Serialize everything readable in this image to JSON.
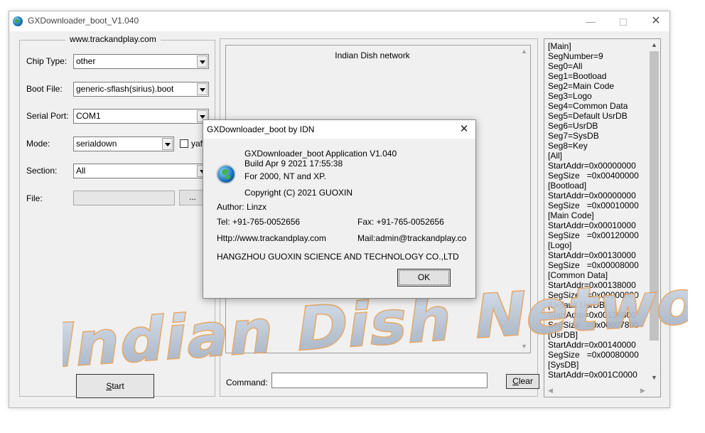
{
  "window": {
    "title": "GXDownloader_boot_V1.040",
    "min_glyph": "—",
    "close_glyph": "✕"
  },
  "left_panel": {
    "group_title": "www.trackandplay.com",
    "chip_type_label": "Chip Type:",
    "chip_type_value": "other",
    "boot_file_label": "Boot File:",
    "boot_file_value": "generic-sflash(sirius).boot",
    "serial_port_label": "Serial Port:",
    "serial_port_value": "COM1",
    "mode_label": "Mode:",
    "mode_value": "serialdown",
    "mode_checkbox_label": "yaf",
    "section_label": "Section:",
    "section_value": "All",
    "file_label": "File:",
    "file_value": "",
    "browse_label": "...",
    "start_label_first": "S",
    "start_label_rest": "tart"
  },
  "log": {
    "header": "Indian Dish network",
    "command_label": "Command:",
    "command_value": "",
    "clear_label_first": "C",
    "clear_label_rest": "lear"
  },
  "config_list": [
    "[Main]",
    "SegNumber=9",
    "Seg0=All",
    "Seg1=Bootload",
    "Seg2=Main Code",
    "Seg3=Logo",
    "Seg4=Common Data",
    "Seg5=Default UsrDB",
    "Seg6=UsrDB",
    "Seg7=SysDB",
    "Seg8=Key",
    "[All]",
    "StartAddr=0x00000000",
    "SegSize   =0x00400000",
    "[Bootload]",
    "StartAddr=0x00000000",
    "SegSize   =0x00010000",
    "[Main Code]",
    "StartAddr=0x00010000",
    "SegSize   =0x00120000",
    "[Logo]",
    "StartAddr=0x00130000",
    "SegSize   =0x00008000",
    "[Common Data]",
    "StartAddr=0x00138000",
    "SegSize   =0x00000800",
    "[Default UsrDB]",
    "StartAddr=0x00138800",
    "SegSize   =0x00007800",
    "[UsrDB]",
    "StartAddr=0x00140000",
    "SegSize   =0x00080000",
    "[SysDB]",
    "StartAddr=0x001C0000"
  ],
  "about_dialog": {
    "title": "GXDownloader_boot by IDN",
    "app_line": "GXDownloader_boot Application V1.040",
    "build_line": "Build Apr  9 2021 17:55:38",
    "platform_line": "For 2000, NT and XP.",
    "copyright_line": "Copyright (C) 2021  GUOXIN",
    "author_line": "Author: Linzx",
    "tel_line": "Tel: +91-765-0052656",
    "fax_line": "Fax: +91-765-0052656",
    "http_line": "Http://www.trackandplay.com",
    "mail_line": "Mail:admin@trackandplay.co",
    "company_line": "HANGZHOU GUOXIN SCIENCE AND TECHNOLOGY CO.,LTD",
    "ok_label": "OK",
    "close_glyph": "✕"
  },
  "watermark": {
    "text": "Indian Dish Network"
  },
  "icons": {
    "app": "globe-icon",
    "dialog": "globe-icon",
    "scroll_up": "▲",
    "scroll_down": "▼",
    "scroll_left": "◀",
    "scroll_right": "▶"
  }
}
